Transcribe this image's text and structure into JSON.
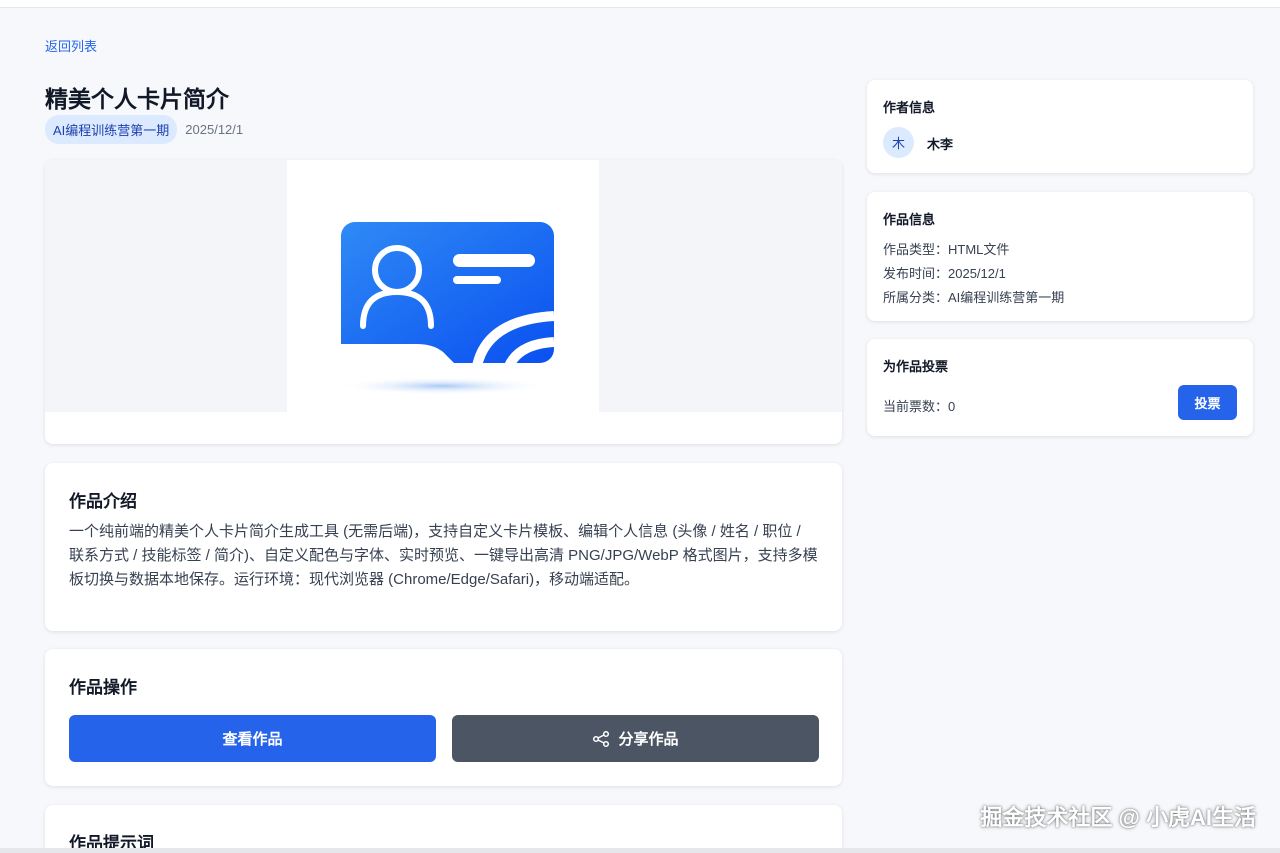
{
  "nav": {
    "back_label": "返回列表"
  },
  "work": {
    "title": "精美个人卡片简介",
    "category": "AI编程训练营第一期",
    "date": "2025/12/1"
  },
  "intro": {
    "heading": "作品介绍",
    "text": "一个纯前端的精美个人卡片简介生成工具 (无需后端)，支持自定义卡片模板、编辑个人信息 (头像 / 姓名 / 职位 / 联系方式 / 技能标签 / 简介)、自定义配色与字体、实时预览、一键导出高清 PNG/JPG/WebP 格式图片，支持多模板切换与数据本地保存。运行环境：现代浏览器 (Chrome/Edge/Safari)，移动端适配。"
  },
  "operations": {
    "heading": "作品操作",
    "view_label": "查看作品",
    "share_label": "分享作品"
  },
  "prompt": {
    "heading": "作品提示词"
  },
  "author": {
    "heading": "作者信息",
    "avatar_char": "木",
    "name": "木李"
  },
  "info": {
    "heading": "作品信息",
    "type_row": "作品类型：HTML文件",
    "time_row": "发布时间：2025/12/1",
    "category_row": "所属分类：AI编程训练营第一期"
  },
  "vote": {
    "heading": "为作品投票",
    "count_text": "当前票数：0",
    "button_label": "投票"
  },
  "watermark": "掘金技术社区 @ 小虎AI生活",
  "colors": {
    "primary": "#2563eb",
    "secondary": "#4b5563",
    "tag_bg": "#dbeafe"
  },
  "icons": {
    "cover": "id-card-icon",
    "share": "share-icon"
  }
}
